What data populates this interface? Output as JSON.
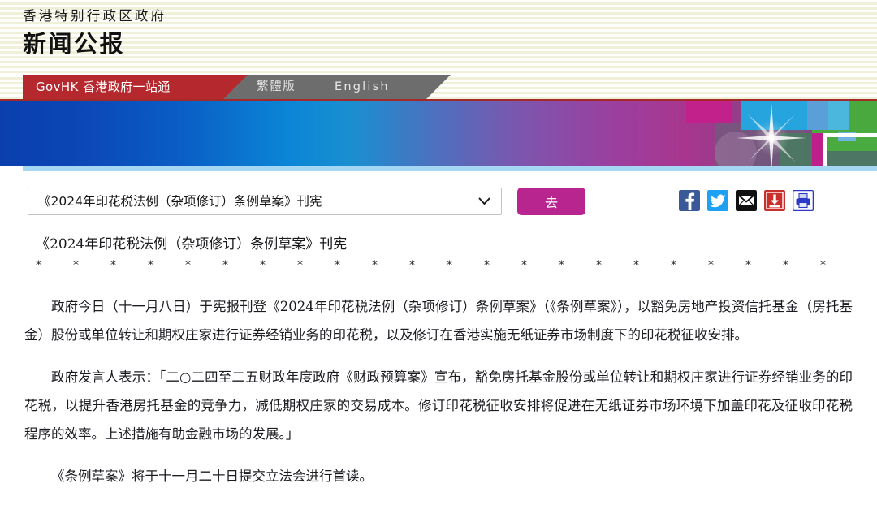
{
  "masthead": {
    "gov_name": "香港特别行政区政府",
    "title": "新闻公报"
  },
  "nav": {
    "brand": "GovHK 香港政府一站通",
    "links": [
      {
        "label": "繁體版",
        "name": "nav-link-traditional-chinese"
      },
      {
        "label": "English",
        "name": "nav-link-english"
      }
    ]
  },
  "controls": {
    "select_value": "《2024年印花税法例（杂项修订）条例草案》刊宪",
    "select_chevron": "⌄",
    "go_label": "去",
    "icons": [
      {
        "name": "facebook-icon",
        "glyph": "f",
        "color": "#3b5998"
      },
      {
        "name": "twitter-icon",
        "glyph": "",
        "color": "#1da1f2"
      },
      {
        "name": "email-icon",
        "glyph": "",
        "color": "#000000"
      },
      {
        "name": "save-icon",
        "glyph": "",
        "color": "#c9302c"
      },
      {
        "name": "print-icon",
        "glyph": "",
        "color": "#2b39c7"
      }
    ]
  },
  "article": {
    "title": "《2024年印花税法例（杂项修订）条例草案》刊宪",
    "separator": "*　*　*　*　*　*　*　*　*　*　*　*　*　*　*　*　*　*　*　*　*　*",
    "paragraphs": [
      "政府今日（十一月八日）于宪报刊登《2024年印花税法例（杂项修订）条例草案》（《条例草案》），以豁免房地产投资信托基金（房托基金）股份或单位转让和期权庄家进行证券经销业务的印花税，以及修订在香港实施无纸证券市场制度下的印花税征收安排。",
      "政府发言人表示：「二○二四至二五财政年度政府《财政预算案》宣布，豁免房托基金股份或单位转让和期权庄家进行证券经销业务的印花税，以提升香港房托基金的竞争力，减低期权庄家的交易成本。修订印花税征收安排将促进在无纸证券市场环境下加盖印花及征收印花税程序的效率。上述措施有助金融市场的发展。」",
      "《条例草案》将于十一月二十日提交立法会进行首读。"
    ]
  },
  "colors": {
    "masthead_bg": "#f8f8e9",
    "nav_red": "#b4282e",
    "nav_gray": "#6d6d6d",
    "go_button": "#b9258f",
    "banner_underline": "#a5d7f5"
  }
}
